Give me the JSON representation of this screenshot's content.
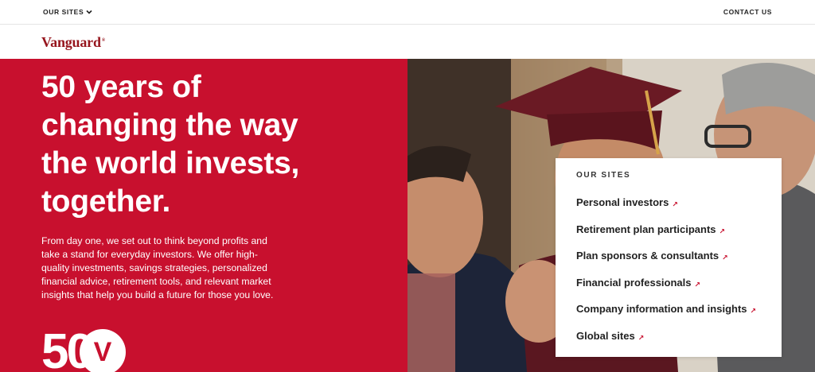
{
  "utility_bar": {
    "our_sites_label": "OUR SITES",
    "contact_label": "CONTACT US"
  },
  "header": {
    "logo_text": "Vanguard",
    "logo_mark": "®"
  },
  "hero": {
    "title_lines": [
      "50 years of",
      "changing the way",
      "the world invests,",
      "together."
    ],
    "body_lines": [
      "From day one, we set out to think beyond profits and",
      "take a stand for everyday investors. We offer high-",
      "quality investments, savings strategies, personalized",
      "financial advice, retirement tools, and relevant market",
      "insights that help you build a future for those you love."
    ],
    "anniversary_digits": "50",
    "anniversary_mark": "V"
  },
  "sites_menu": {
    "title": "OUR SITES",
    "items": [
      {
        "label": "Personal investors",
        "icon": "external-arrow-icon"
      },
      {
        "label": "Retirement plan participants",
        "icon": "external-arrow-icon"
      },
      {
        "label": "Plan sponsors & consultants",
        "icon": "external-arrow-icon"
      },
      {
        "label": "Financial professionals",
        "icon": "external-arrow-icon"
      },
      {
        "label": "Company information and insights",
        "icon": "external-arrow-icon"
      },
      {
        "label": "Global sites",
        "icon": "external-arrow-icon"
      }
    ]
  },
  "colors": {
    "brand_red": "#c8102e",
    "logo_red": "#96151d",
    "text_dark": "#222222"
  }
}
